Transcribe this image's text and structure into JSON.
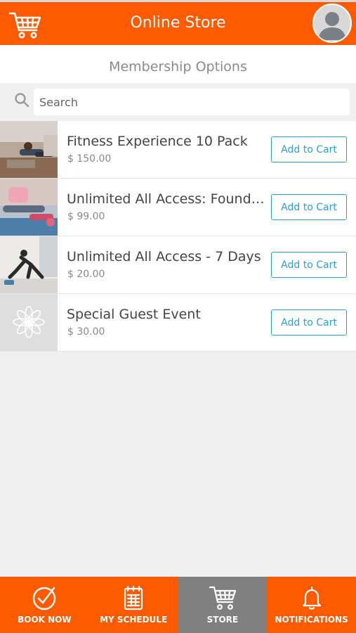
{
  "header": {
    "title": "Online Store",
    "cart_icon": "shopping-cart-icon",
    "avatar_icon": "user-avatar-icon"
  },
  "subheader": {
    "title": "Membership Options"
  },
  "search": {
    "placeholder": "Search",
    "icon": "search-icon"
  },
  "products": [
    {
      "name": "Fitness Experience 10 Pack",
      "price": "$ 150.00",
      "button": "Add to Cart"
    },
    {
      "name": "Unlimited All Access: Founde...",
      "price": "$ 99.00",
      "button": "Add to Cart"
    },
    {
      "name": "Unlimited All Access - 7 Days",
      "price": "$ 20.00",
      "button": "Add to Cart"
    },
    {
      "name": "Special Guest Event",
      "price": "$ 30.00",
      "button": "Add to Cart"
    }
  ],
  "bottom_nav": [
    {
      "label": "BOOK NOW",
      "icon": "check-circle-icon",
      "active": false
    },
    {
      "label": "MY SCHEDULE",
      "icon": "calendar-icon",
      "active": false
    },
    {
      "label": "STORE",
      "icon": "shopping-cart-icon",
      "active": true
    },
    {
      "label": "NOTIFICATIONS",
      "icon": "bell-icon",
      "active": false
    }
  ],
  "colors": {
    "brand_orange": "#fe5a00",
    "active_nav": "#808080",
    "button_blue": "#2aa0d6",
    "background": "#f0f0f0"
  }
}
